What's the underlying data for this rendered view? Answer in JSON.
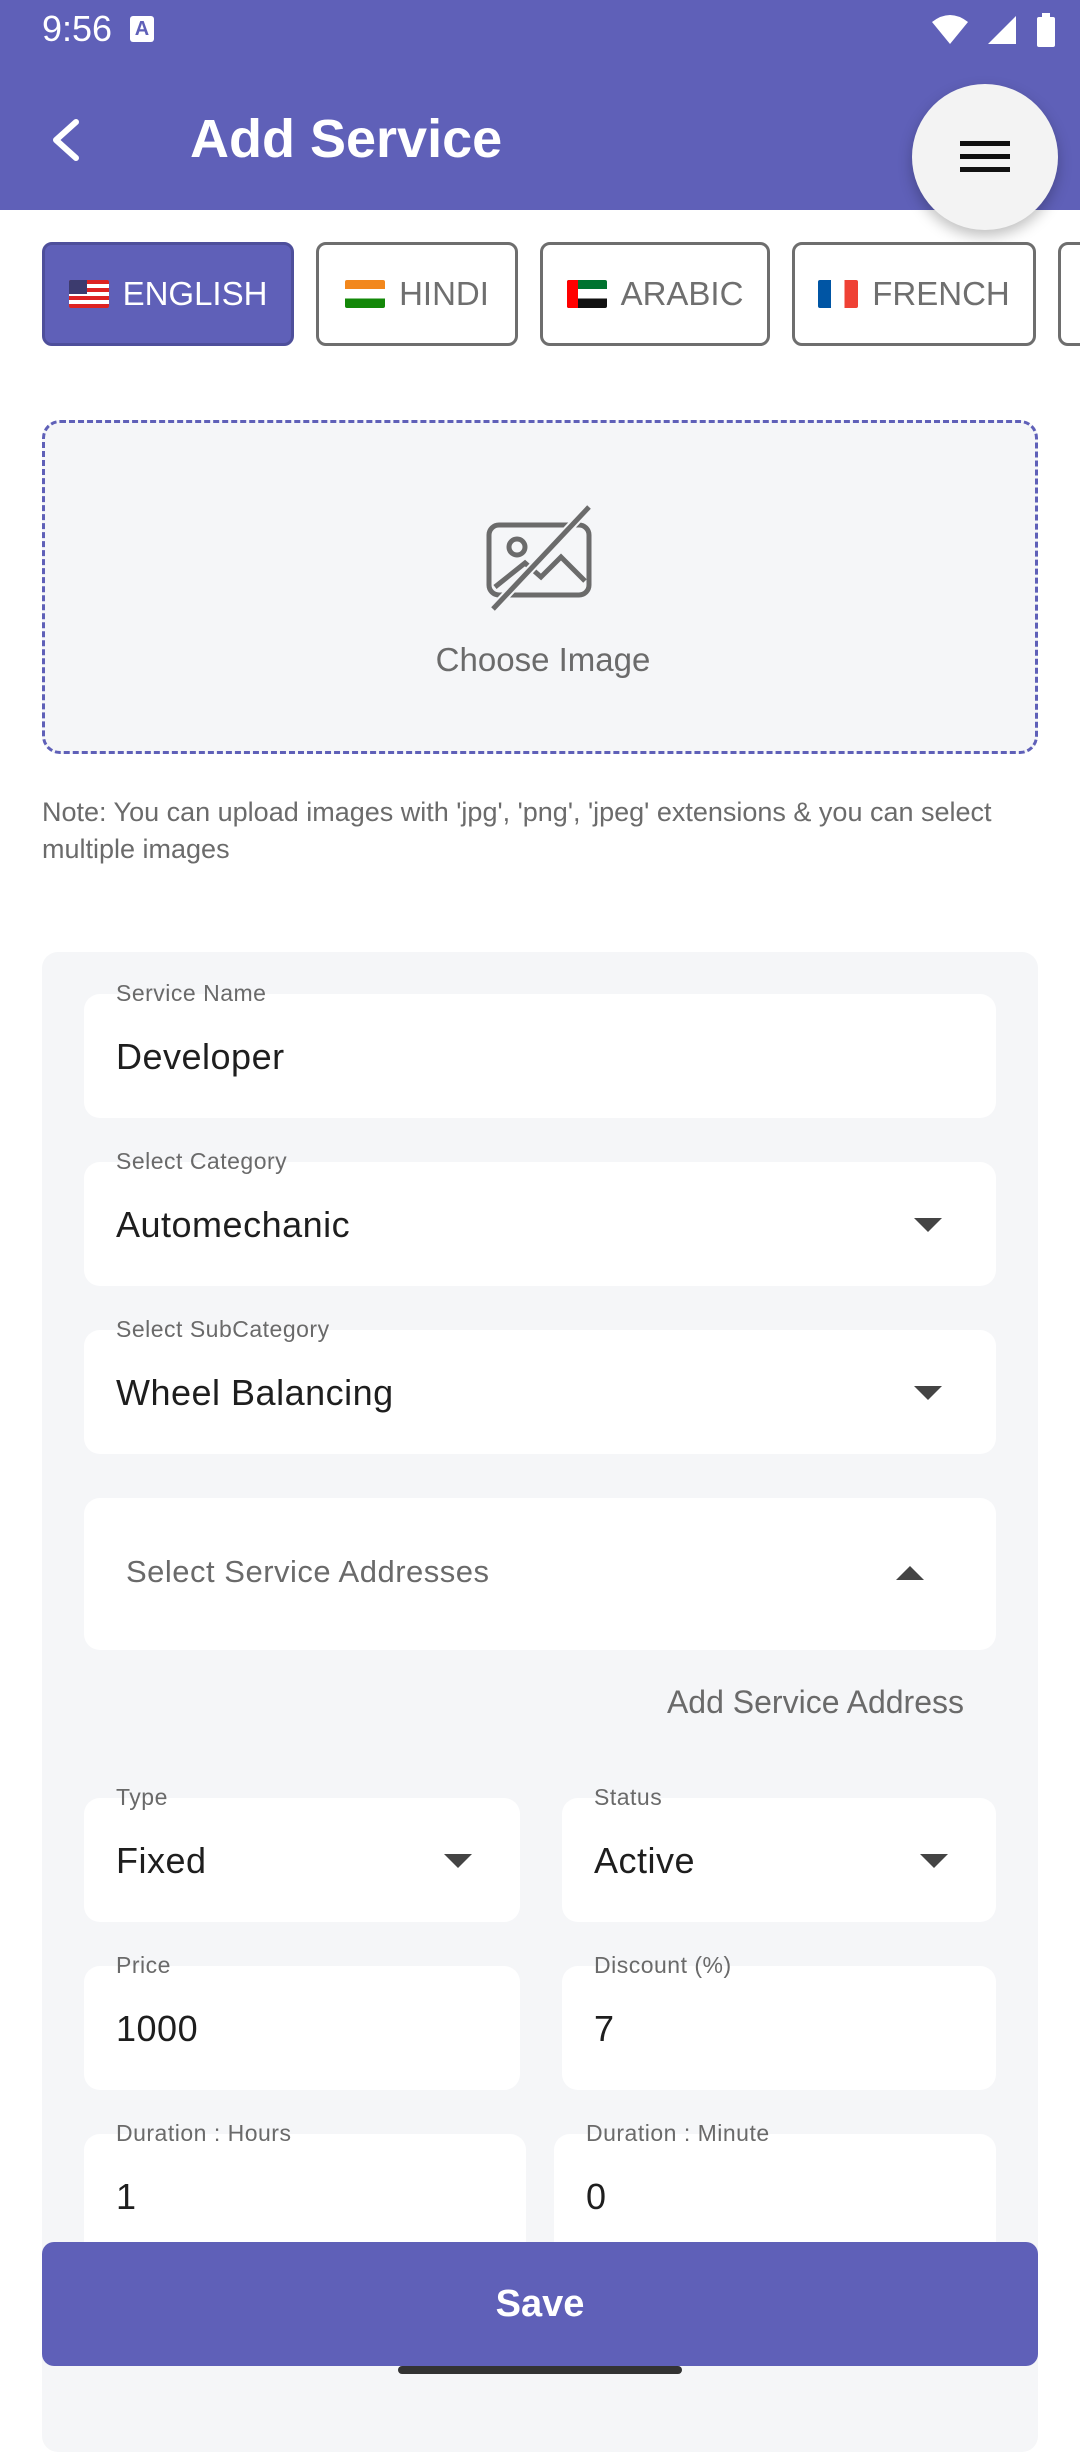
{
  "status": {
    "time": "9:56",
    "a_badge": "A"
  },
  "header": {
    "title": "Add Service"
  },
  "icons": {
    "back": "back-arrow-icon",
    "menu": "hamburger-menu-icon",
    "image": "image-off-icon"
  },
  "colors": {
    "primary": "#5F60B8",
    "card_bg": "#f5f6f8"
  },
  "languages": [
    {
      "label": "ENGLISH",
      "flag": "us",
      "selected": true
    },
    {
      "label": "HINDI",
      "flag": "in",
      "selected": false
    },
    {
      "label": "ARABIC",
      "flag": "ae",
      "selected": false
    },
    {
      "label": "FRENCH",
      "flag": "fr",
      "selected": false
    }
  ],
  "upload": {
    "label": "Choose Image",
    "note": "Note: You can upload images with 'jpg', 'png', 'jpeg' extensions & you can select multiple images"
  },
  "form": {
    "service_name": {
      "label": "Service Name",
      "value": "Developer"
    },
    "category": {
      "label": "Select Category",
      "value": "Automechanic"
    },
    "subcategory": {
      "label": "Select SubCategory",
      "value": "Wheel Balancing"
    },
    "addresses": {
      "placeholder": "Select Service Addresses"
    },
    "add_address_link": "Add Service Address",
    "type": {
      "label": "Type",
      "value": "Fixed"
    },
    "status": {
      "label": "Status",
      "value": "Active"
    },
    "price": {
      "label": "Price",
      "value": "1000"
    },
    "discount": {
      "label": "Discount (%)",
      "value": "7"
    },
    "duration_hours": {
      "label": "Duration : Hours",
      "value": "1"
    },
    "duration_minutes": {
      "label": "Duration : Minute",
      "value": "0"
    }
  },
  "actions": {
    "save": "Save"
  }
}
